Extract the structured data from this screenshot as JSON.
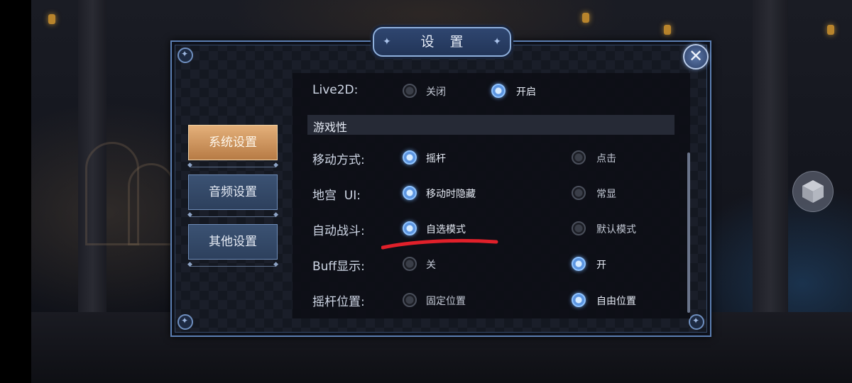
{
  "dialog": {
    "title": "设 置",
    "close_symbol": "✕"
  },
  "sidebar": {
    "items": [
      {
        "label": "系统设置",
        "active": true
      },
      {
        "label": "音频设置",
        "active": false
      },
      {
        "label": "其他设置",
        "active": false
      }
    ]
  },
  "settings": {
    "live2d": {
      "label": "Live2D:",
      "options": [
        "关闭",
        "开启"
      ],
      "selected": 1
    },
    "section_title": "游戏性",
    "rows": [
      {
        "label": "移动方式:",
        "options": [
          "摇杆",
          "点击"
        ],
        "selected": 0
      },
      {
        "label": "地宫  UI:",
        "options": [
          "移动时隐藏",
          "常显"
        ],
        "selected": 0
      },
      {
        "label": "自动战斗:",
        "options": [
          "自选模式",
          "默认模式"
        ],
        "selected": 0
      },
      {
        "label": "Buff显示:",
        "options": [
          "关",
          "开"
        ],
        "selected": 1
      },
      {
        "label": "摇杆位置:",
        "options": [
          "固定位置",
          "自由位置"
        ],
        "selected": 1
      }
    ]
  },
  "colors": {
    "accent": "#8fc3ff",
    "active_tab": "#d49a62",
    "annotation": "#e0202a"
  },
  "icons": {
    "close": "close-icon",
    "cube": "cube-icon"
  }
}
